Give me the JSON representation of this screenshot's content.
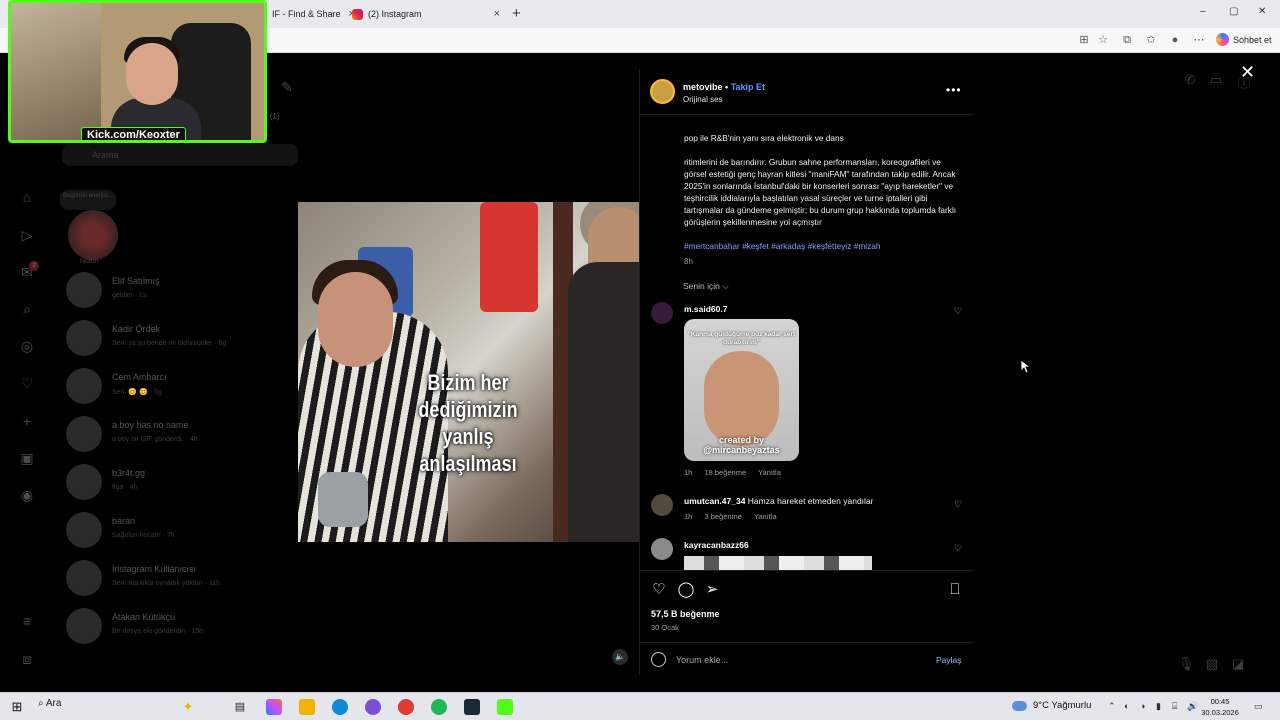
{
  "browser": {
    "tabs": [
      {
        "label": "IF - Find & Share",
        "close": "×"
      },
      {
        "label": "(2) Instagram",
        "close": "×"
      }
    ],
    "new_tab": "+",
    "window_controls": [
      "–",
      "▢",
      "✕"
    ],
    "copilot_label": "Sohbet et"
  },
  "instagram": {
    "search_placeholder": "Arama",
    "request_label": "est (1)",
    "note_label": "Notun",
    "note_bubble": "Bugünün enerjisi...",
    "dm_list": [
      {
        "name": "Elif Satılmış",
        "snippet": "geldim · 1s"
      },
      {
        "name": "Kadir Ördek",
        "snippet": "Sen: ya şu bende mi öldürsünler · 5g"
      },
      {
        "name": "Cem Ambarcı",
        "snippet": "Sen: 😊 😊 · 6g"
      },
      {
        "name": "a boy has no name",
        "snippet": "a boy bir GIF gönderdi. · 4h"
      },
      {
        "name": "b3r4t.gg",
        "snippet": "flga · 4h"
      },
      {
        "name": "baran",
        "snippet": "Sağolun hocam · 7h"
      },
      {
        "name": "Instagram Kullanıcısı",
        "snippet": "Sen: Karılıkla oynadık yoktun · 11h"
      },
      {
        "name": "Atakan Kütükçü",
        "snippet": "Bir dosya eki gönderdin · 15h"
      }
    ],
    "sidebar_badge": "2"
  },
  "modal": {
    "close": "✕",
    "video_caption": [
      "Bizim her",
      "dediğimizin",
      "yanlış",
      "anlaşılması"
    ],
    "mute_icon": "🔈",
    "post": {
      "username": "metovibe",
      "separator": "•",
      "follow_label": "Takip Et",
      "audio_label": "Orijinal ses",
      "more": "•••",
      "text_line1": "pop ile R&B'nin yanı sıra elektronik ve dans",
      "text_body": "ritimlerini de barındırır. Grubun sahne performansları, koreografileri ve görsel estetiği genç hayran kitlesi \"maniFAM\" tarafından takip edilir. Ancak 2025'in sonlarında İstanbul'daki bir konserleri sonrası \"ayıp hareketler\" ve teşhircilik iddialarıyla başlatılan yasal süreçler ve turne iptalleri gibi tartışmalar da gündeme gelmiştir; bu durum grup hakkında toplumda farklı görüşlerin şekillenmesine yol açmıştır",
      "hashtags": "#mertcanbahar #keşfet #arkadaş #keşfetteyiz #mizah",
      "time": "8h",
      "for_you_label": "Senin için ⌵"
    },
    "comments": [
      {
        "username": "m.said60.7",
        "text": "",
        "gif_top_text": "\"Kanma güldüğüme buz kadar sert durabilirim\"",
        "gif_bottom_text": "created by @mircanbeyaztas",
        "time": "1h",
        "likes": "18 beğenme",
        "reply": "Yanıtla"
      },
      {
        "username": "umutcan.47_34",
        "text": "Hamza hareket etmeden yandılar",
        "time": "1h",
        "likes": "3 beğenme",
        "reply": "Yanıtla"
      },
      {
        "username": "kayracanbazz66",
        "text": ""
      }
    ],
    "like_count": "57,5 B beğenme",
    "date": "30 Ocak",
    "comment_placeholder": "Yorum ekle...",
    "share_label": "Paylaş"
  },
  "webcam": {
    "label": "Kick.com/Keoxter"
  },
  "taskbar": {
    "search_label": "Ara",
    "weather": "9°C  Yağmurlu",
    "time": "00:45",
    "date": "30.03.2026"
  },
  "colors": {
    "link_blue": "#5b97ff",
    "kick_green": "#53fc18",
    "panel_bg": "#000000"
  }
}
